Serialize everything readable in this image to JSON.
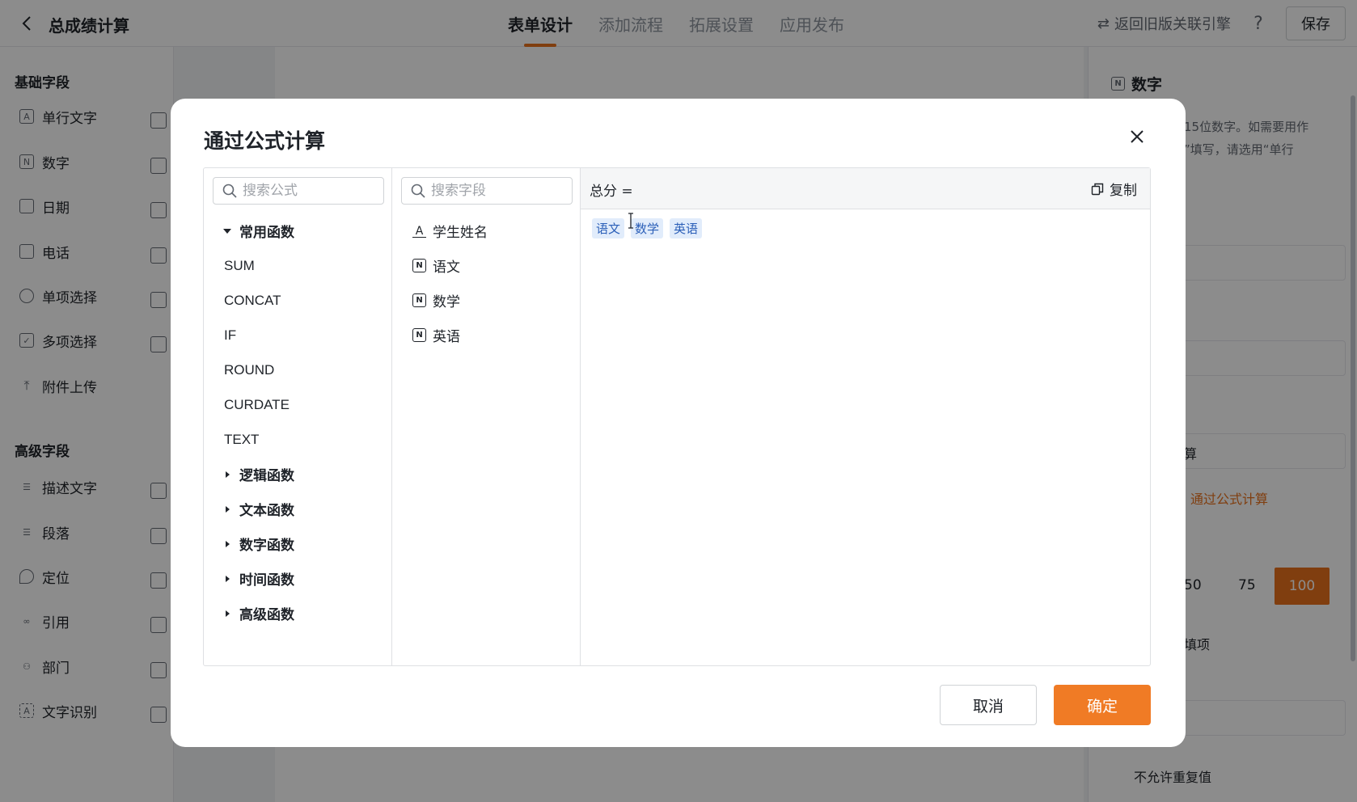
{
  "app": {
    "title": "总成绩计算",
    "tabs": [
      "表单设计",
      "添加流程",
      "拓展设置",
      "应用发布"
    ],
    "active_tab": "表单设计",
    "legacy_link": "返回旧版关联引擎",
    "help": "?",
    "save": "保存"
  },
  "sidebar": {
    "basic_title": "基础字段",
    "basic_items": [
      "单行文字",
      "数字",
      "日期",
      "电话",
      "单项选择",
      "多项选择",
      "附件上传"
    ],
    "advanced_title": "高级字段",
    "advanced_items": [
      "描述文字",
      "段落",
      "定位",
      "引用",
      "部门",
      "文字识别"
    ]
  },
  "right_panel": {
    "title": "数字",
    "hint_line1": "15位数字。如需要用作",
    "hint_line2": "”填写，请选用“单行",
    "select_partial": "算",
    "link_partial": "通过公式计算",
    "num_50": "50",
    "num_75": "75",
    "num_100": "100",
    "required_partial": "填项",
    "no_duplicate": "不允许重复值"
  },
  "dialog": {
    "title": "通过公式计算",
    "formula_search_placeholder": "搜索公式",
    "field_search_placeholder": "搜索字段",
    "common_group": "常用函数",
    "common_functions": [
      "SUM",
      "CONCAT",
      "IF",
      "ROUND",
      "CURDATE",
      "TEXT"
    ],
    "other_groups": [
      "逻辑函数",
      "文本函数",
      "数字函数",
      "时间函数",
      "高级函数"
    ],
    "fields": [
      {
        "label": "学生姓名",
        "icon": "text-field-icon"
      },
      {
        "label": "语文",
        "icon": "number-field-icon"
      },
      {
        "label": "数学",
        "icon": "number-field-icon"
      },
      {
        "label": "英语",
        "icon": "number-field-icon"
      }
    ],
    "formula_label": "总分 =",
    "copy": "复制",
    "tokens": [
      "语文",
      "数学",
      "英语"
    ],
    "cancel": "取消",
    "confirm": "确定"
  },
  "colors": {
    "accent": "#f07b25",
    "token_bg": "#e1ecfb",
    "token_text": "#2b5fb8"
  }
}
